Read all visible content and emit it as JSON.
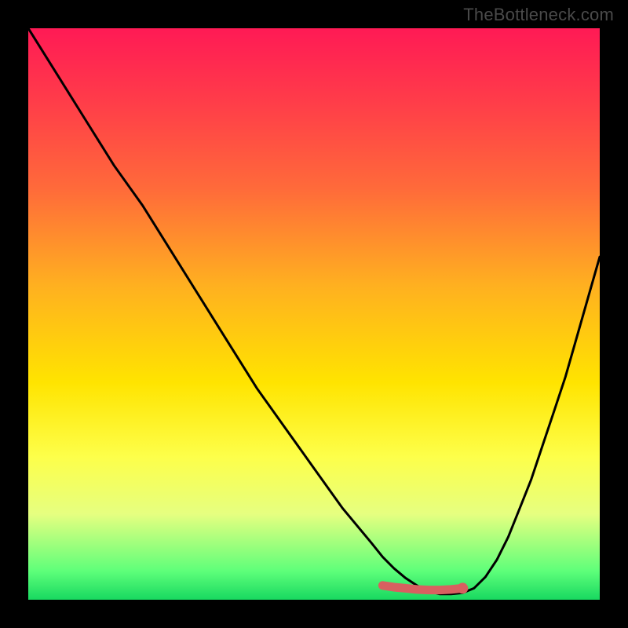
{
  "watermark": "TheBottleneck.com",
  "chart_data": {
    "type": "line",
    "title": "",
    "xlabel": "",
    "ylabel": "",
    "xlim": [
      0,
      100
    ],
    "ylim": [
      0,
      100
    ],
    "grid": false,
    "legend": false,
    "series": [
      {
        "name": "bottleneck-curve",
        "color": "#000000",
        "x": [
          0,
          5,
          10,
          15,
          20,
          25,
          30,
          35,
          40,
          45,
          50,
          55,
          60,
          62,
          64,
          66,
          68,
          70,
          72,
          74,
          76,
          78,
          80,
          82,
          84,
          86,
          88,
          90,
          92,
          94,
          96,
          98,
          100
        ],
        "values": [
          100,
          92,
          84,
          76,
          69,
          61,
          53,
          45,
          37,
          30,
          23,
          16,
          10,
          7.5,
          5.5,
          3.8,
          2.5,
          1.5,
          1.0,
          1.0,
          1.2,
          2.0,
          4.0,
          7.0,
          11,
          16,
          21,
          27,
          33,
          39,
          46,
          53,
          60
        ]
      },
      {
        "name": "optimal-range",
        "color": "#d86060",
        "x": [
          62,
          64,
          66,
          68,
          70,
          72,
          74,
          76
        ],
        "values": [
          2.5,
          2.2,
          2.0,
          1.8,
          1.7,
          1.7,
          1.8,
          2.0
        ]
      }
    ],
    "markers": [
      {
        "name": "optimal-point",
        "x": 76,
        "y": 2.0,
        "color": "#d86060"
      }
    ],
    "background_gradient": {
      "top": "#ff1a55",
      "mid": "#ffe400",
      "bottom": "#18d860"
    }
  }
}
